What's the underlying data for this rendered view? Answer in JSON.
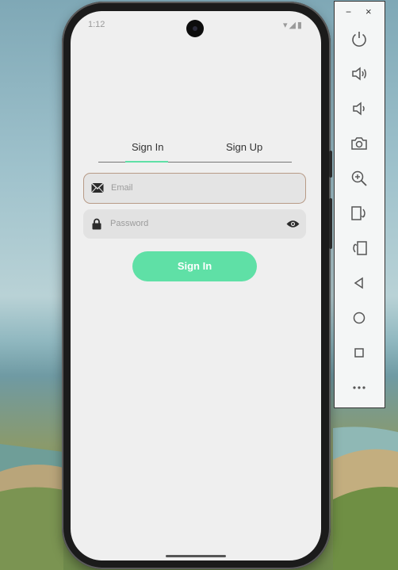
{
  "status_bar": {
    "time": "1:12",
    "icons": "▾◢▮"
  },
  "tabs": [
    {
      "label": "Sign In",
      "selected": true
    },
    {
      "label": "Sign Up",
      "selected": false
    }
  ],
  "email_field": {
    "placeholder": "Email",
    "icon": "mail-icon"
  },
  "password_field": {
    "placeholder": "Password",
    "icon": "lock-icon",
    "toggle_icon": "eye-icon"
  },
  "signin_button": {
    "label": "Sign In"
  },
  "emulator_toolbar": {
    "minimize": "−",
    "close": "×",
    "buttons": [
      "power-icon",
      "volume-up-icon",
      "volume-down-icon",
      "camera-icon",
      "zoom-icon",
      "rotate-left-icon",
      "rotate-right-icon",
      "back-icon",
      "home-icon",
      "overview-icon",
      "more-icon"
    ]
  },
  "colors": {
    "accent": "#5fe0a6",
    "screen_bg": "#efefef",
    "field_bg": "#e2e2e2"
  }
}
